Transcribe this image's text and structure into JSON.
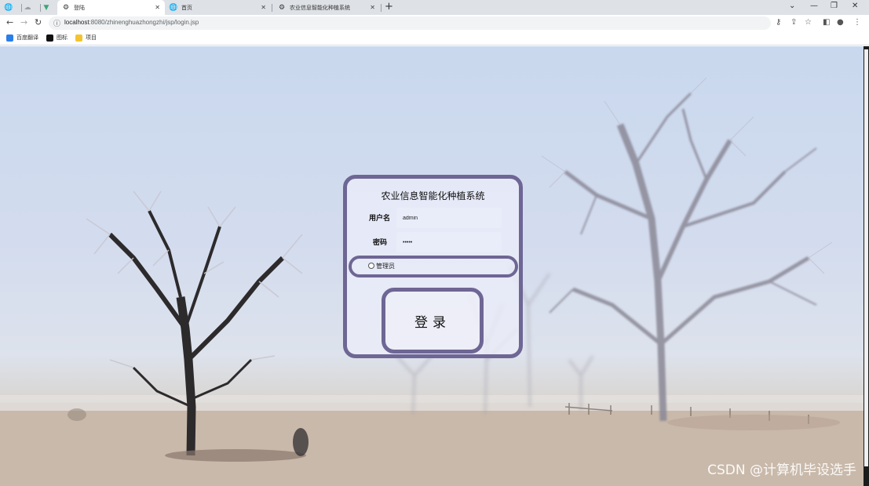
{
  "browser": {
    "tabs": [
      {
        "title": "",
        "icon": "globe-icon"
      },
      {
        "title": "",
        "icon": "cloud-icon"
      },
      {
        "title": "",
        "icon": "vue-icon"
      },
      {
        "title": "登陆",
        "icon": "settings-icon",
        "active": true
      },
      {
        "title": "首页",
        "icon": "globe-icon"
      },
      {
        "title": "农业信息智能化种植系统",
        "icon": "settings-icon"
      }
    ],
    "new_tab_label": "+",
    "url_host": "localhost",
    "url_rest": ":8080/zhinenghuazhongzhi/jsp/login.jsp",
    "bookmarks": [
      {
        "label": "百度翻译",
        "color": "#2b7de9"
      },
      {
        "label": "图标",
        "color": "#111111"
      },
      {
        "label": "项目",
        "color": "#f4c430"
      }
    ]
  },
  "login": {
    "title": "农业信息智能化种植系统",
    "username_label": "用户名",
    "username_value": "admin",
    "password_label": "密码",
    "password_value": "•••••",
    "role_option": "管理员",
    "submit_label": "登录"
  },
  "watermark": "CSDN @计算机毕设选手",
  "colors": {
    "accent_border": "#6e6694"
  }
}
